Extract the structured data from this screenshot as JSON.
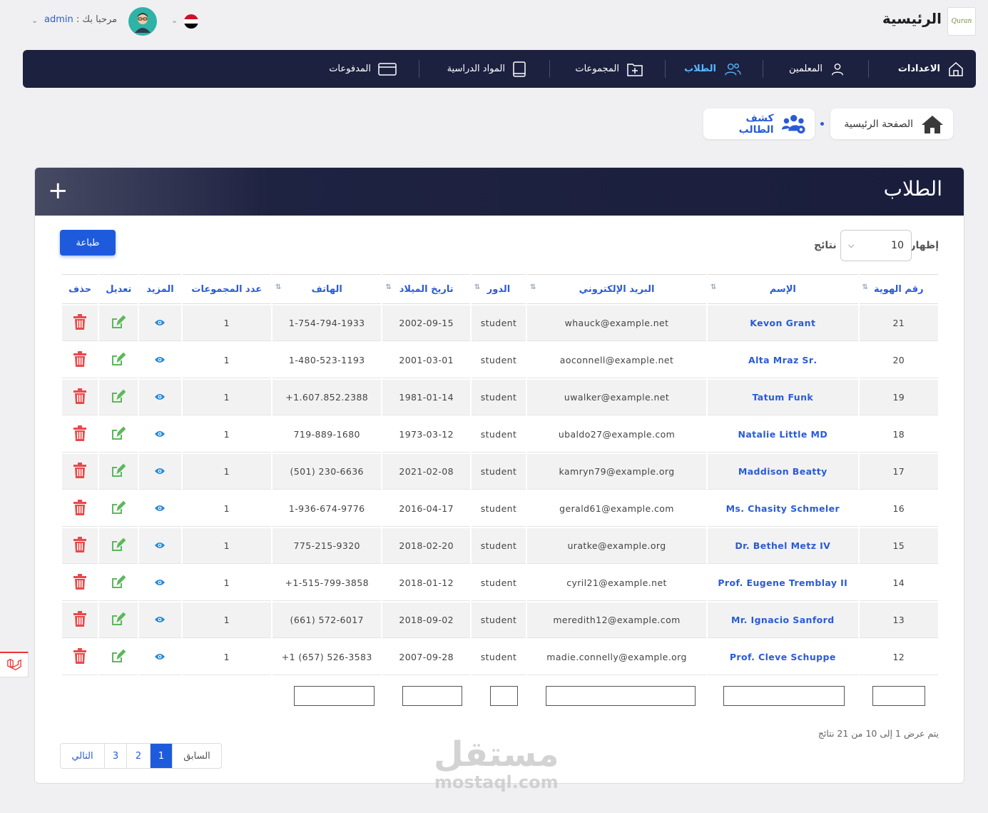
{
  "header": {
    "site_title": "الرئيسية",
    "logo_text": "Quran",
    "greeting": "مرحبا بك :",
    "username": "admin"
  },
  "nav": {
    "items": [
      {
        "label": "الاعدادات",
        "icon": "home-icon"
      },
      {
        "label": "المعلمين",
        "icon": "user-icon"
      },
      {
        "label": "الطلاب",
        "icon": "users-icon",
        "active": true
      },
      {
        "label": "المجموعات",
        "icon": "folder-plus-icon"
      },
      {
        "label": "المواد الدراسية",
        "icon": "book-icon"
      },
      {
        "label": "المدفوعات",
        "icon": "credit-card-icon"
      }
    ]
  },
  "breadcrumb": {
    "home": "الصفحة الرئيسية",
    "current": "كشف الطالب"
  },
  "card": {
    "title": "الطلاب",
    "add_symbol": "+",
    "print_label": "طباعة",
    "length_prefix": "إظهار",
    "length_value": "10",
    "length_suffix": "نتائج"
  },
  "table": {
    "columns": [
      "رقم الهوية",
      "الإسم",
      "البريد الإلكتروني",
      "الدور",
      "تاريخ الميلاد",
      "الهاتف",
      "عدد المجموعات",
      "المزيد",
      "تعديل",
      "حذف"
    ],
    "rows": [
      [
        "21",
        "Kevon Grant",
        "whauck@example.net",
        "student",
        "2002-09-15",
        "1-754-794-1933",
        "1"
      ],
      [
        "20",
        ".Alta Mraz Sr",
        "aoconnell@example.net",
        "student",
        "2001-03-01",
        "1-480-523-1193",
        "1"
      ],
      [
        "19",
        "Tatum Funk",
        "uwalker@example.net",
        "student",
        "1981-01-14",
        "1.607.852.2388+",
        "1"
      ],
      [
        "18",
        "Natalie Little MD",
        "ubaldo27@example.com",
        "student",
        "1973-03-12",
        "719-889-1680",
        "1"
      ],
      [
        "17",
        "Maddison Beatty",
        "kamryn79@example.org",
        "student",
        "2021-02-08",
        "230-6636 (501)",
        "1"
      ],
      [
        "16",
        "Ms. Chasity Schmeler",
        "gerald61@example.com",
        "student",
        "2016-04-17",
        "1-936-674-9776",
        "1"
      ],
      [
        "15",
        "Dr. Bethel Metz IV",
        "uratke@example.org",
        "student",
        "2018-02-20",
        "775-215-9320",
        "1"
      ],
      [
        "14",
        "Prof. Eugene Tremblay II",
        "cyril21@example.net",
        "student",
        "2018-01-12",
        "1-515-799-3858+",
        "1"
      ],
      [
        "13",
        "Mr. Ignacio Sanford",
        "meredith12@example.com",
        "student",
        "2018-09-02",
        "572-6017 (661)",
        "1"
      ],
      [
        "12",
        "Prof. Cleve Schuppe",
        "madie.connelly@example.org",
        "student",
        "2007-09-28",
        "526-3583 (657) 1+",
        "1"
      ]
    ]
  },
  "footer": {
    "info": "يتم عرض 1 إلى 10 من 21 نتائج",
    "prev": "السابق",
    "pages": [
      "1",
      "2",
      "3"
    ],
    "next": "التالي"
  },
  "watermark": {
    "line1": "مستقل",
    "line2": "mostaql.com"
  },
  "colors": {
    "nav_bg": "#1d2140",
    "accent": "#1e5bdc",
    "active_nav": "#58b7ff",
    "delete": "#e84a4a",
    "edit": "#5cb85c"
  }
}
